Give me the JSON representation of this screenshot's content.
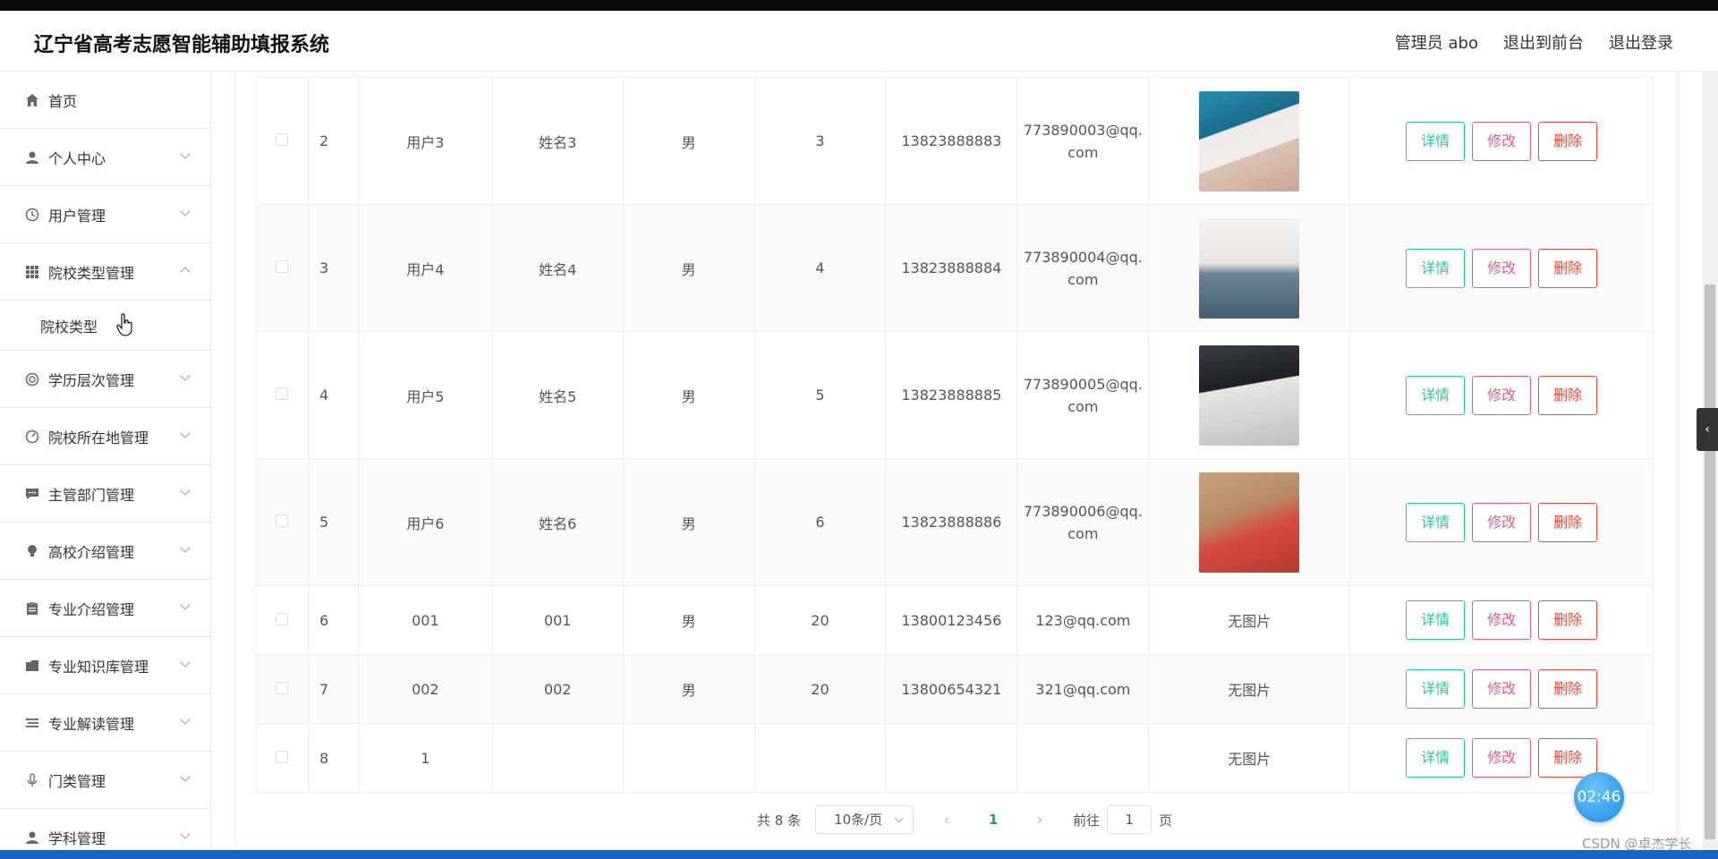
{
  "app": {
    "title": "辽宁省高考志愿智能辅助填报系统"
  },
  "header": {
    "user": "管理员 abo",
    "to_front": "退出到前台",
    "logout": "退出登录"
  },
  "sidebar": {
    "items": [
      {
        "label": "首页",
        "icon": "home-icon"
      },
      {
        "label": "个人中心",
        "icon": "user-icon"
      },
      {
        "label": "用户管理",
        "icon": "clock-icon"
      },
      {
        "label": "院校类型管理",
        "icon": "grid-icon",
        "expanded": true
      },
      {
        "label": "学历层次管理",
        "icon": "circle-icon"
      },
      {
        "label": "院校所在地管理",
        "icon": "dashboard-icon"
      },
      {
        "label": "主管部门管理",
        "icon": "message-icon"
      },
      {
        "label": "高校介绍管理",
        "icon": "bulb-icon"
      },
      {
        "label": "专业介绍管理",
        "icon": "clipboard-icon"
      },
      {
        "label": "专业知识库管理",
        "icon": "folder-icon"
      },
      {
        "label": "专业解读管理",
        "icon": "list-icon"
      },
      {
        "label": "门类管理",
        "icon": "mic-icon"
      },
      {
        "label": "学科管理",
        "icon": "person-icon"
      }
    ],
    "submenu": {
      "label": "院校类型"
    }
  },
  "table": {
    "actions": {
      "detail": "详情",
      "edit": "修改",
      "delete": "删除"
    },
    "no_image": "无图片",
    "rows": [
      {
        "idx": "2",
        "username": "用户3",
        "name": "姓名3",
        "gender": "男",
        "age": "3",
        "phone": "13823888883",
        "email": "773890003@qq.com",
        "email_l1": "773890003@qq.",
        "email_l2": "com",
        "photo": true
      },
      {
        "idx": "3",
        "username": "用户4",
        "name": "姓名4",
        "gender": "男",
        "age": "4",
        "phone": "13823888884",
        "email": "773890004@qq.com",
        "email_l1": "773890004@qq.",
        "email_l2": "com",
        "photo": true
      },
      {
        "idx": "4",
        "username": "用户5",
        "name": "姓名5",
        "gender": "男",
        "age": "5",
        "phone": "13823888885",
        "email": "773890005@qq.com",
        "email_l1": "773890005@qq.",
        "email_l2": "com",
        "photo": true
      },
      {
        "idx": "5",
        "username": "用户6",
        "name": "姓名6",
        "gender": "男",
        "age": "6",
        "phone": "13823888886",
        "email": "773890006@qq.com",
        "email_l1": "773890006@qq.",
        "email_l2": "com",
        "photo": true
      },
      {
        "idx": "6",
        "username": "001",
        "name": "001",
        "gender": "男",
        "age": "20",
        "phone": "13800123456",
        "email": "123@qq.com",
        "photo": false
      },
      {
        "idx": "7",
        "username": "002",
        "name": "002",
        "gender": "男",
        "age": "20",
        "phone": "13800654321",
        "email": "321@qq.com",
        "photo": false
      },
      {
        "idx": "8",
        "username": "1",
        "name": "",
        "gender": "",
        "age": "",
        "phone": "",
        "email": "",
        "photo": false
      }
    ]
  },
  "pagination": {
    "total": "共 8 条",
    "page_size": "10条/页",
    "current": "1",
    "goto": "前往",
    "goto_value": "1",
    "page_word": "页",
    "prev": "‹",
    "next": "›"
  },
  "overlay": {
    "timer": "02:46",
    "watermark": "CSDN @卓杰学长"
  }
}
